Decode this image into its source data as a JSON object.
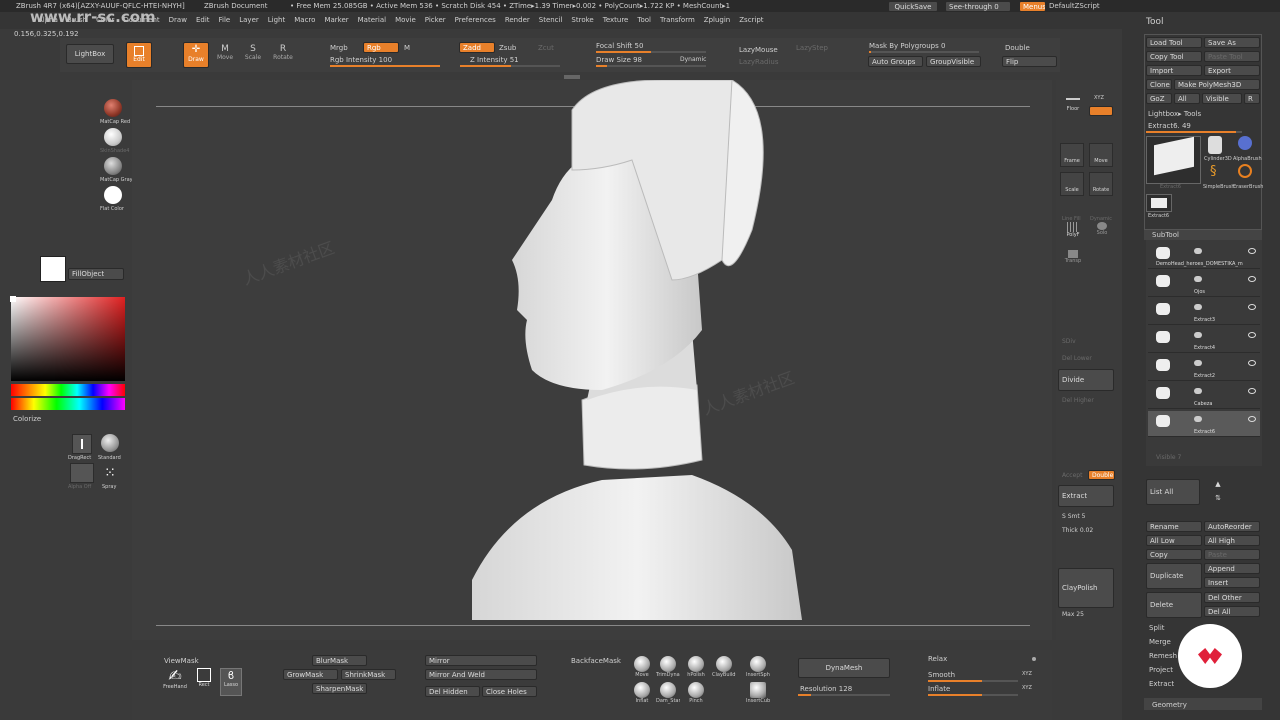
{
  "title_bar": {
    "watermark_url": "www.rr-sc.com",
    "app": "ZBrush 4R7 (x64)[AZXY-AUUF-QFLC-HTEI-NHYH]",
    "document": "ZBrush Document",
    "stats": "• Free Mem 25.085GB • Active Mem 536 • Scratch Disk 454 • ZTime▸1.39 Timer▸0.002 • PolyCount▸1.722 KP • MeshCount▸1",
    "quicksave": "QuickSave",
    "see_through": "See-through 0",
    "menus": "Menus",
    "default_script": "DefaultZScript"
  },
  "menu_items": [
    "Alpha",
    "Brush",
    "Color",
    "Document",
    "Draw",
    "Edit",
    "File",
    "Layer",
    "Light",
    "Macro",
    "Marker",
    "Material",
    "Movie",
    "Picker",
    "Preferences",
    "Render",
    "Stencil",
    "Stroke",
    "Texture",
    "Tool",
    "Transform",
    "Zplugin",
    "Zscript"
  ],
  "coords": "0.156,0.325,0.192",
  "top_shelf": {
    "lightbox": "LightBox",
    "edit": "Edit",
    "draw": "Draw",
    "move": "Move",
    "scale": "Scale",
    "rotate": "Rotate",
    "mrgb": "Mrgb",
    "rgb": "Rgb",
    "m": "M",
    "rgb_intensity": "Rgb Intensity 100",
    "zadd": "Zadd",
    "zsub": "Zsub",
    "zcut": "Zcut",
    "z_intensity": "Z Intensity 51",
    "focal_shift": "Focal Shift 50",
    "draw_size": "Draw Size 98",
    "dynamic": "Dynamic",
    "lazymouse": "LazyMouse",
    "lazystep": "LazyStep",
    "lazyradius": "LazyRadius",
    "mask_by_polygroups": "Mask By Polygroups 0",
    "auto_groups": "Auto Groups",
    "group_visible": "GroupVisible",
    "double": "Double",
    "flip": "Flip"
  },
  "left_shelf": {
    "materials": [
      "MatCap Red",
      "SkinShade4",
      "MatCap Gray",
      "Flat Color"
    ],
    "fill_object": "FillObject",
    "colorize": "Colorize",
    "drag_rect": "DragRect",
    "standard": "Standard",
    "alpha_off": "Alpha Off",
    "spray": "Spray"
  },
  "right_shelf": {
    "floor": "Floor",
    "xyz": "XYZ",
    "frame": "Frame",
    "move": "Move",
    "scale": "Scale",
    "rotate": "Rotate",
    "line_fill": "Line Fill",
    "polyf": "PolyF",
    "dynamic": "Dynamic",
    "solo": "Solo",
    "transp": "Transp",
    "sdiv": "SDiv",
    "del_lower": "Del Lower",
    "divide": "Divide",
    "del_higher": "Del Higher",
    "accept": "Accept",
    "double": "Double",
    "extract": "Extract",
    "s_smt": "S Smt 5",
    "thick": "Thick 0.02",
    "claypolish": "ClayPolish",
    "max": "Max 25"
  },
  "tool_panel": {
    "title": "Tool",
    "load_tool": "Load Tool",
    "save_as": "Save As",
    "copy_tool": "Copy Tool",
    "paste_tool": "Paste Tool",
    "import": "Import",
    "export": "Export",
    "clone": "Clone",
    "make_polymesh": "Make PolyMesh3D",
    "goz": "GoZ",
    "all": "All",
    "visible": "Visible",
    "r": "R",
    "lightbox_tools": "Lightbox▸ Tools",
    "current_tool": "Extract6. 49",
    "thumbs": [
      "Extract6",
      "Cylinder3D",
      "AlphaBrush",
      "SimpleBrush",
      "EraserBrush",
      "Extract6"
    ],
    "subtool_title": "SubTool",
    "subtools": [
      "DemoHead_heroes_DOMESTIKA_m",
      "Ojos",
      "Extract3",
      "Extract4",
      "Extract2",
      "Cabeza",
      "Extract6"
    ],
    "visible_count": "Visible 7",
    "list_all": "List All",
    "rename": "Rename",
    "auto_reorder": "AutoReorder",
    "all_low": "All Low",
    "all_high": "All High",
    "copy": "Copy",
    "paste": "Paste",
    "duplicate": "Duplicate",
    "append": "Append",
    "insert": "Insert",
    "delete": "Delete",
    "del_other": "Del Other",
    "del_all": "Del All",
    "split": "Split",
    "merge": "Merge",
    "remesh": "Remesh",
    "project": "Project",
    "extract": "Extract",
    "geometry": "Geometry"
  },
  "bottom_shelf": {
    "viewmask": "ViewMask",
    "freehand": "FreeHand",
    "rect": "Rect",
    "lasso": "Lasso",
    "blurmask": "BlurMask",
    "growmask": "GrowMask",
    "shrinkmask": "ShrinkMask",
    "sharpenmask": "SharpenMask",
    "mirror": "Mirror",
    "mirror_and_weld": "Mirror And Weld",
    "del_hidden": "Del Hidden",
    "close_holes": "Close Holes",
    "backface_mask": "BackfaceMask",
    "brushes": [
      "Move",
      "TrimDynamic",
      "hPolish",
      "ClayBuildup",
      "InsertSphere",
      "Inflat",
      "Dam_Standard",
      "Pinch",
      "InsertCube"
    ],
    "dynamesh": "DynaMesh",
    "resolution": "Resolution 128",
    "relax": "Relax",
    "smooth": "Smooth",
    "inflate": "Inflate",
    "xyz1": "XYZ",
    "xyz2": "XYZ"
  },
  "watermark": "人人素材社区"
}
